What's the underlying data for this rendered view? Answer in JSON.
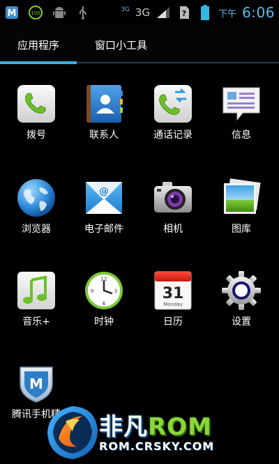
{
  "statusbar": {
    "network_small": "3G",
    "network": "3G",
    "ampm": "下午",
    "time": "6:06"
  },
  "tabs": {
    "apps": "应用程序",
    "widgets": "窗口小工具"
  },
  "apps": [
    {
      "label": "拨号",
      "icon": "phone-icon"
    },
    {
      "label": "联系人",
      "icon": "contacts-icon"
    },
    {
      "label": "通话记录",
      "icon": "call-log-icon"
    },
    {
      "label": "信息",
      "icon": "messaging-icon"
    },
    {
      "label": "浏览器",
      "icon": "browser-globe-icon"
    },
    {
      "label": "电子邮件",
      "icon": "email-icon"
    },
    {
      "label": "相机",
      "icon": "camera-icon"
    },
    {
      "label": "图库",
      "icon": "gallery-icon"
    },
    {
      "label": "音乐+",
      "icon": "music-icon"
    },
    {
      "label": "时钟",
      "icon": "clock-icon"
    },
    {
      "label": "日历",
      "icon": "calendar-icon"
    },
    {
      "label": "设置",
      "icon": "settings-gear-icon"
    },
    {
      "label": "腾讯手机精",
      "icon": "tencent-security-icon"
    }
  ],
  "calendar_icon": {
    "day": "31",
    "weekday": "Monday"
  },
  "watermark": {
    "brand_cn": "非凡",
    "brand_rom": "ROM",
    "url": "ROM.CRSKY.COM"
  },
  "colors": {
    "accent": "#33b5e5",
    "time": "#5fb8ec"
  }
}
